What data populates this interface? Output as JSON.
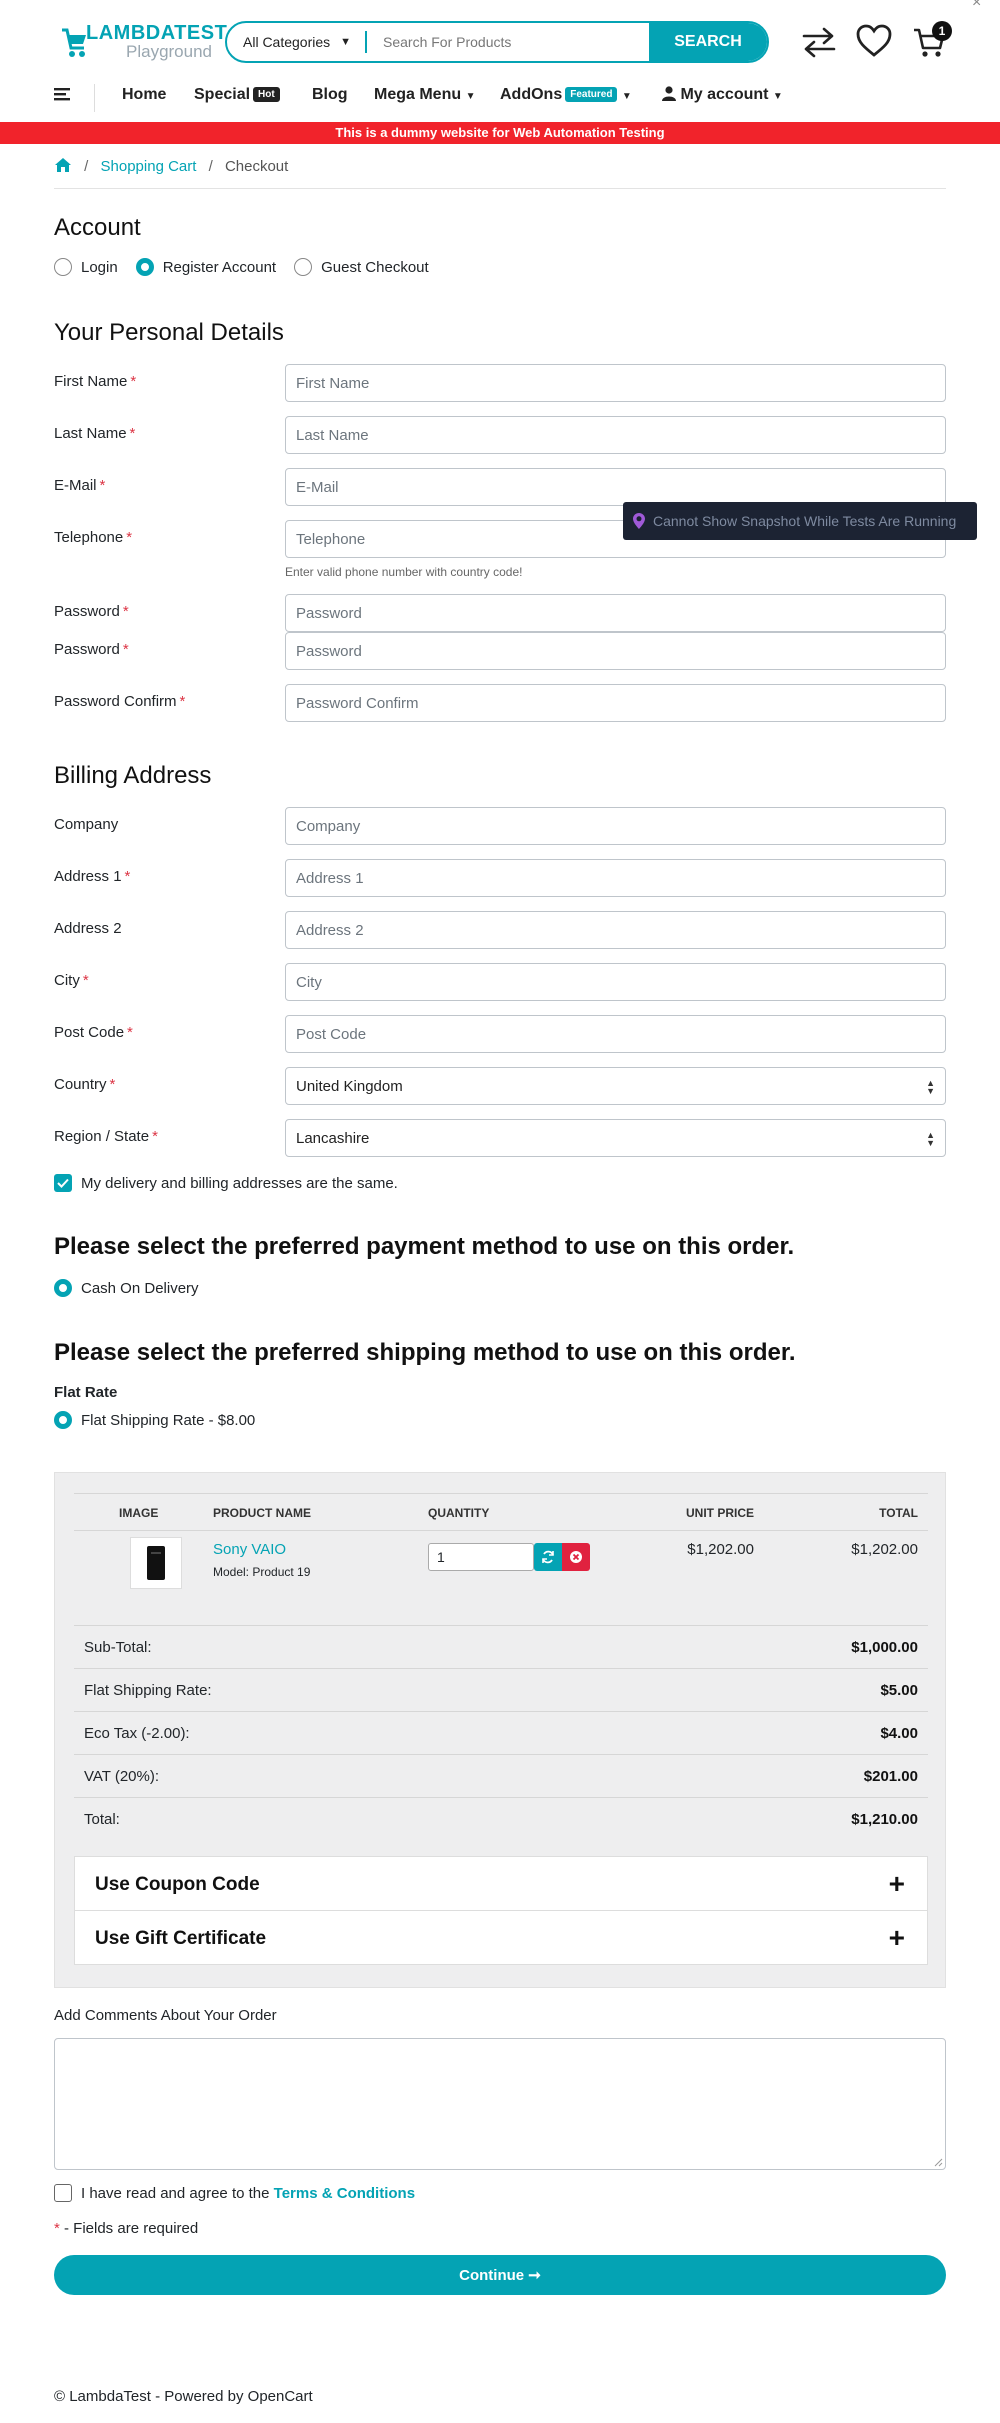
{
  "header": {
    "logo_line1": "LAMBDATEST",
    "logo_line2": "Playground",
    "search_category": "All Categories",
    "search_placeholder": "Search For Products",
    "search_button": "SEARCH",
    "cart_count": "1",
    "close_glyph": "×"
  },
  "nav": {
    "home": "Home",
    "special": "Special",
    "special_tag": "Hot",
    "blog": "Blog",
    "mega_menu": "Mega Menu",
    "addons": "AddOns",
    "addons_tag": "Featured",
    "my_account": "My account"
  },
  "banner": "This is a dummy website for Web Automation Testing",
  "breadcrumb": {
    "sep": "/",
    "cart": "Shopping Cart",
    "current": "Checkout"
  },
  "account": {
    "title": "Account",
    "options": [
      "Login",
      "Register Account",
      "Guest Checkout"
    ],
    "selected": "Register Account"
  },
  "personal": {
    "title": "Your Personal Details",
    "first_name": {
      "label": "First Name",
      "placeholder": "First Name"
    },
    "last_name": {
      "label": "Last Name",
      "placeholder": "Last Name"
    },
    "email": {
      "label": "E-Mail",
      "placeholder": "E-Mail"
    },
    "telephone": {
      "label": "Telephone",
      "placeholder": "Telephone",
      "hint": "Enter valid phone number with country code!"
    },
    "password1": {
      "label": "Password",
      "placeholder": "Password"
    },
    "password2": {
      "label": "Password",
      "placeholder": "Password"
    },
    "password_confirm": {
      "label": "Password Confirm",
      "placeholder": "Password Confirm"
    },
    "required_mark": "*"
  },
  "tooltip": "Cannot Show Snapshot While Tests Are Running",
  "billing": {
    "title": "Billing Address",
    "company": {
      "label": "Company",
      "placeholder": "Company"
    },
    "address1": {
      "label": "Address 1",
      "placeholder": "Address 1"
    },
    "address2": {
      "label": "Address 2",
      "placeholder": "Address 2"
    },
    "city": {
      "label": "City",
      "placeholder": "City"
    },
    "postcode": {
      "label": "Post Code",
      "placeholder": "Post Code"
    },
    "country": {
      "label": "Country",
      "value": "United Kingdom"
    },
    "region": {
      "label": "Region / State",
      "value": "Lancashire"
    },
    "same_address": "My delivery and billing addresses are the same."
  },
  "payment": {
    "title": "Please select the preferred payment method to use on this order.",
    "option": "Cash On Delivery"
  },
  "shipping": {
    "title": "Please select the preferred shipping method to use on this order.",
    "group": "Flat Rate",
    "option": "Flat Shipping Rate - $8.00"
  },
  "cart": {
    "headers": {
      "image": "IMAGE",
      "name": "PRODUCT NAME",
      "quantity": "QUANTITY",
      "unit_price": "UNIT PRICE",
      "total": "TOTAL"
    },
    "item": {
      "name": "Sony VAIO",
      "model": "Model: Product 19",
      "quantity": "1",
      "unit_price": "$1,202.00",
      "total": "$1,202.00"
    },
    "totals": [
      {
        "label": "Sub-Total:",
        "value": "$1,000.00"
      },
      {
        "label": "Flat Shipping Rate:",
        "value": "$5.00"
      },
      {
        "label": "Eco Tax (-2.00):",
        "value": "$4.00"
      },
      {
        "label": "VAT (20%):",
        "value": "$201.00"
      },
      {
        "label": "Total:",
        "value": "$1,210.00"
      }
    ],
    "coupon": "Use Coupon Code",
    "gift": "Use Gift Certificate",
    "plus": "+"
  },
  "comments_label": "Add Comments About Your Order",
  "terms": {
    "prefix": "I have read and agree to the ",
    "link": "Terms & Conditions"
  },
  "required_note": {
    "mark": "*",
    "text": " - Fields are required"
  },
  "continue_label": "Continue ➞",
  "footer": "© LambdaTest - Powered by OpenCart",
  "colors": {
    "accent": "#04a3b4",
    "banner": "#f1232b",
    "required": "#dc3545",
    "remove": "#e0223f"
  }
}
